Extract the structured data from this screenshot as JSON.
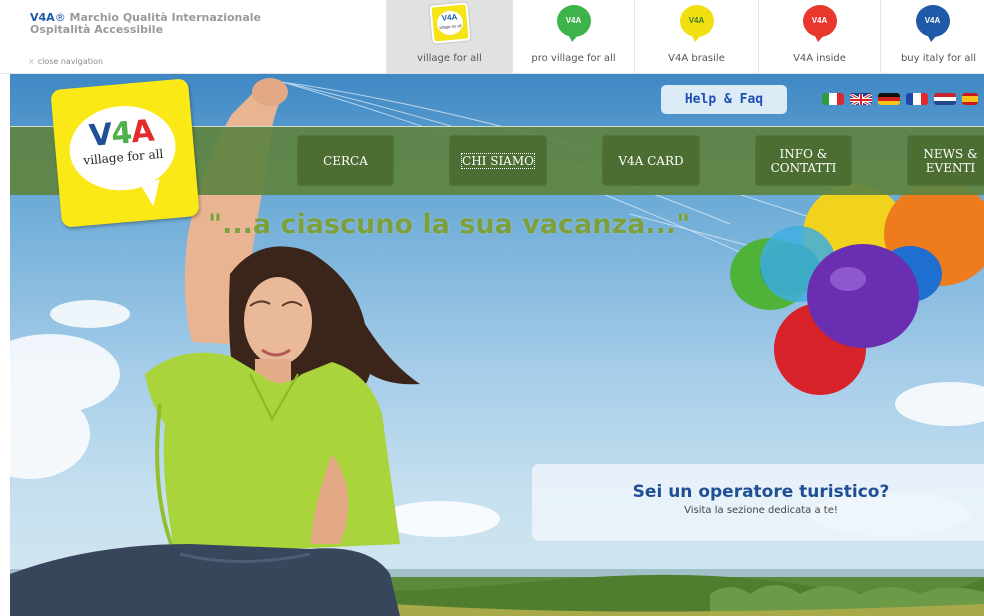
{
  "network": {
    "brand_mark": "V4A",
    "brand_reg": "®",
    "brand_line1": " Marchio Qualità Internazionale",
    "brand_line2": "Ospitalità Accessibile",
    "close_nav": "close navigation",
    "tabs": [
      {
        "label": "village for all",
        "badge": "V4A",
        "sub": "village for all",
        "color": "#f7e416",
        "active": true
      },
      {
        "label": "pro village for all",
        "badge": "V4A",
        "color": "#3db34a",
        "active": false
      },
      {
        "label": "V4A brasile",
        "badge": "V4A",
        "color": "#f2df12",
        "active": false
      },
      {
        "label": "V4A inside",
        "badge": "V4A",
        "color": "#e8382e",
        "active": false
      },
      {
        "label": "buy italy for all",
        "badge": "V4A",
        "color": "#1e5aa8",
        "active": false
      }
    ]
  },
  "header": {
    "help_faq": "Help & Faq",
    "languages": [
      "Italiano",
      "English",
      "Deutsch",
      "Français",
      "Nederlands",
      "Español"
    ]
  },
  "logo": {
    "mark_v": "V",
    "mark_4": "4",
    "mark_a": "A",
    "text": "village for all"
  },
  "menu": [
    {
      "label": "CERCA"
    },
    {
      "label": "CHI SIAMO"
    },
    {
      "label": "V4A CARD"
    },
    {
      "label": "INFO &\nCONTATTI"
    },
    {
      "label": "NEWS &\nEVENTI"
    }
  ],
  "hero": {
    "tagline": "\"...a ciascuno la sua vacanza...\"",
    "operator_title": "Sei un operatore turistico?",
    "operator_sub": "Visita la sezione dedicata a te!"
  },
  "colors": {
    "brand_blue": "#1e5aa8",
    "menu_green": "#5f8442",
    "menu_button": "#4c6e33",
    "tagline_green": "#7da03c",
    "logo_yellow": "#fbe817"
  },
  "icons": {
    "flags": [
      "flag-it-icon",
      "flag-uk-icon",
      "flag-de-icon",
      "flag-fr-icon",
      "flag-nl-icon",
      "flag-es-icon"
    ],
    "balloons": "balloons-illustration"
  }
}
